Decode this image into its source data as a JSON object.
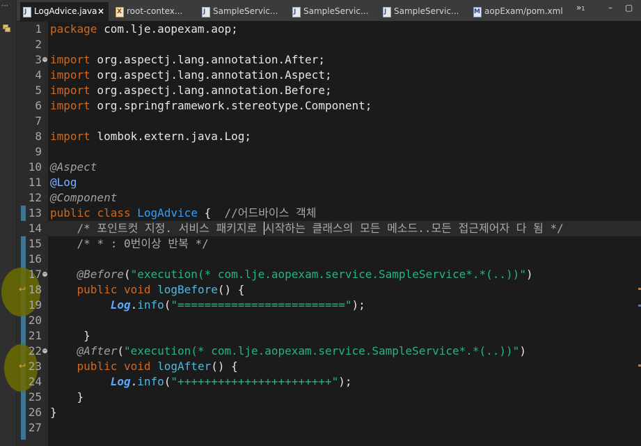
{
  "tabs": [
    {
      "label": "LogAdvice.java",
      "icon": "java-file-icon",
      "active": true,
      "close": "×"
    },
    {
      "label": "root-contex...",
      "icon": "xml-file-icon"
    },
    {
      "label": "SampleServic...",
      "icon": "java-file-icon"
    },
    {
      "label": "SampleServic...",
      "icon": "java-file-icon"
    },
    {
      "label": "SampleServic...",
      "icon": "java-file-icon"
    },
    {
      "label": "aopExam/pom.xml",
      "icon": "maven-pom-icon"
    }
  ],
  "overflow": {
    "chevron": "»",
    "count": "1"
  },
  "window": {
    "minimize": "–",
    "maximize": "▢"
  },
  "editor": {
    "current_line": 14,
    "lines": [
      {
        "n": "1"
      },
      {
        "n": "2"
      },
      {
        "n": "3"
      },
      {
        "n": "4"
      },
      {
        "n": "5"
      },
      {
        "n": "6"
      },
      {
        "n": "7"
      },
      {
        "n": "8"
      },
      {
        "n": "9"
      },
      {
        "n": "10"
      },
      {
        "n": "11"
      },
      {
        "n": "12"
      },
      {
        "n": "13"
      },
      {
        "n": "14"
      },
      {
        "n": "15"
      },
      {
        "n": "16"
      },
      {
        "n": "17"
      },
      {
        "n": "18"
      },
      {
        "n": "19"
      },
      {
        "n": "20"
      },
      {
        "n": "21"
      },
      {
        "n": "22"
      },
      {
        "n": "23"
      },
      {
        "n": "24"
      },
      {
        "n": "25"
      },
      {
        "n": "26"
      },
      {
        "n": "27"
      }
    ],
    "t": {
      "package_kw": "package",
      "package_name": " com.lje.aopexam.aop;",
      "import_kw": "import",
      "imp1": " org.aspectj.lang.annotation.After;",
      "imp2": " org.aspectj.lang.annotation.Aspect;",
      "imp3": " org.aspectj.lang.annotation.Before;",
      "imp4": " org.springframework.stereotype.Component;",
      "imp5": " lombok.extern.java.Log;",
      "ann_aspect": "@Aspect",
      "ann_log": "@Log",
      "ann_component": "@Component",
      "public_kw": "public",
      "class_kw": "class",
      "class_name": "LogAdvice",
      "brace_open": " {",
      "class_comment": "//어드바이스 객체",
      "comment1a": "/* 포인트컷 지정. 서비스 패키지로 ",
      "comment1b": "시작하는 클래스의 모든 메소드..모든 접근제어자 다 됨 */",
      "comment2": "/* * : 0번이상 반복 */",
      "ann_before": "@Before",
      "paren_open": "(",
      "exec_str": "\"execution(* com.lje.aopexam.service.SampleService*.*(..))\"",
      "paren_close": ")",
      "void_kw": "void",
      "m_before": "logBefore",
      "m_after": "logAfter",
      "sig_rest": "() {",
      "log_field": "Log",
      "dot": ".",
      "info": "info",
      "str_eq": "\"=========================\"",
      "str_plus": "\"+++++++++++++++++++++++\"",
      "call_end": ");",
      "ann_after": "@After",
      "close_brace": "}"
    }
  },
  "colors": {
    "background": "#1b1b1b",
    "keyword": "#d2691e",
    "string": "#26b38a",
    "class_name": "#2fa0ff",
    "comment": "#a8a8a8",
    "annotation": "#a0a0a0"
  }
}
